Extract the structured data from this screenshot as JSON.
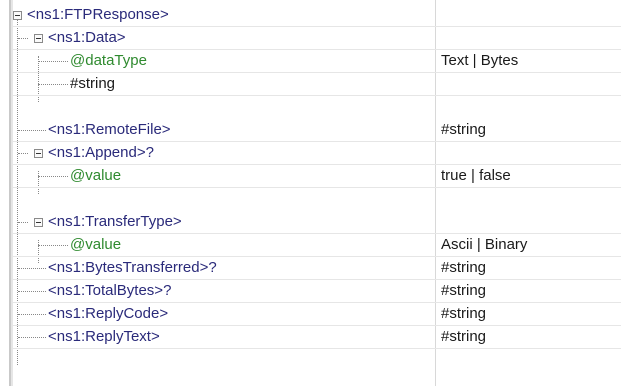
{
  "tree": {
    "rows": [
      {
        "label": "<ns1:FTPResponse>",
        "value": ""
      },
      {
        "label": "<ns1:Data>",
        "value": ""
      },
      {
        "label": "@dataType",
        "value": "Text | Bytes"
      },
      {
        "label": "#string",
        "value": ""
      },
      {
        "label": "<ns1:RemoteFile>",
        "value": "#string"
      },
      {
        "label": "<ns1:Append>?",
        "value": ""
      },
      {
        "label": "@value",
        "value": "true | false"
      },
      {
        "label": "<ns1:TransferType>",
        "value": ""
      },
      {
        "label": "@value",
        "value": "Ascii | Binary"
      },
      {
        "label": "<ns1:BytesTransferred>?",
        "value": "#string"
      },
      {
        "label": "<ns1:TotalBytes>?",
        "value": "#string"
      },
      {
        "label": "<ns1:ReplyCode>",
        "value": "#string"
      },
      {
        "label": "<ns1:ReplyText>",
        "value": "#string"
      }
    ]
  },
  "colors": {
    "element": "#2a2a7a",
    "attribute": "#2f8a2f",
    "text": "#1a1a1a"
  }
}
